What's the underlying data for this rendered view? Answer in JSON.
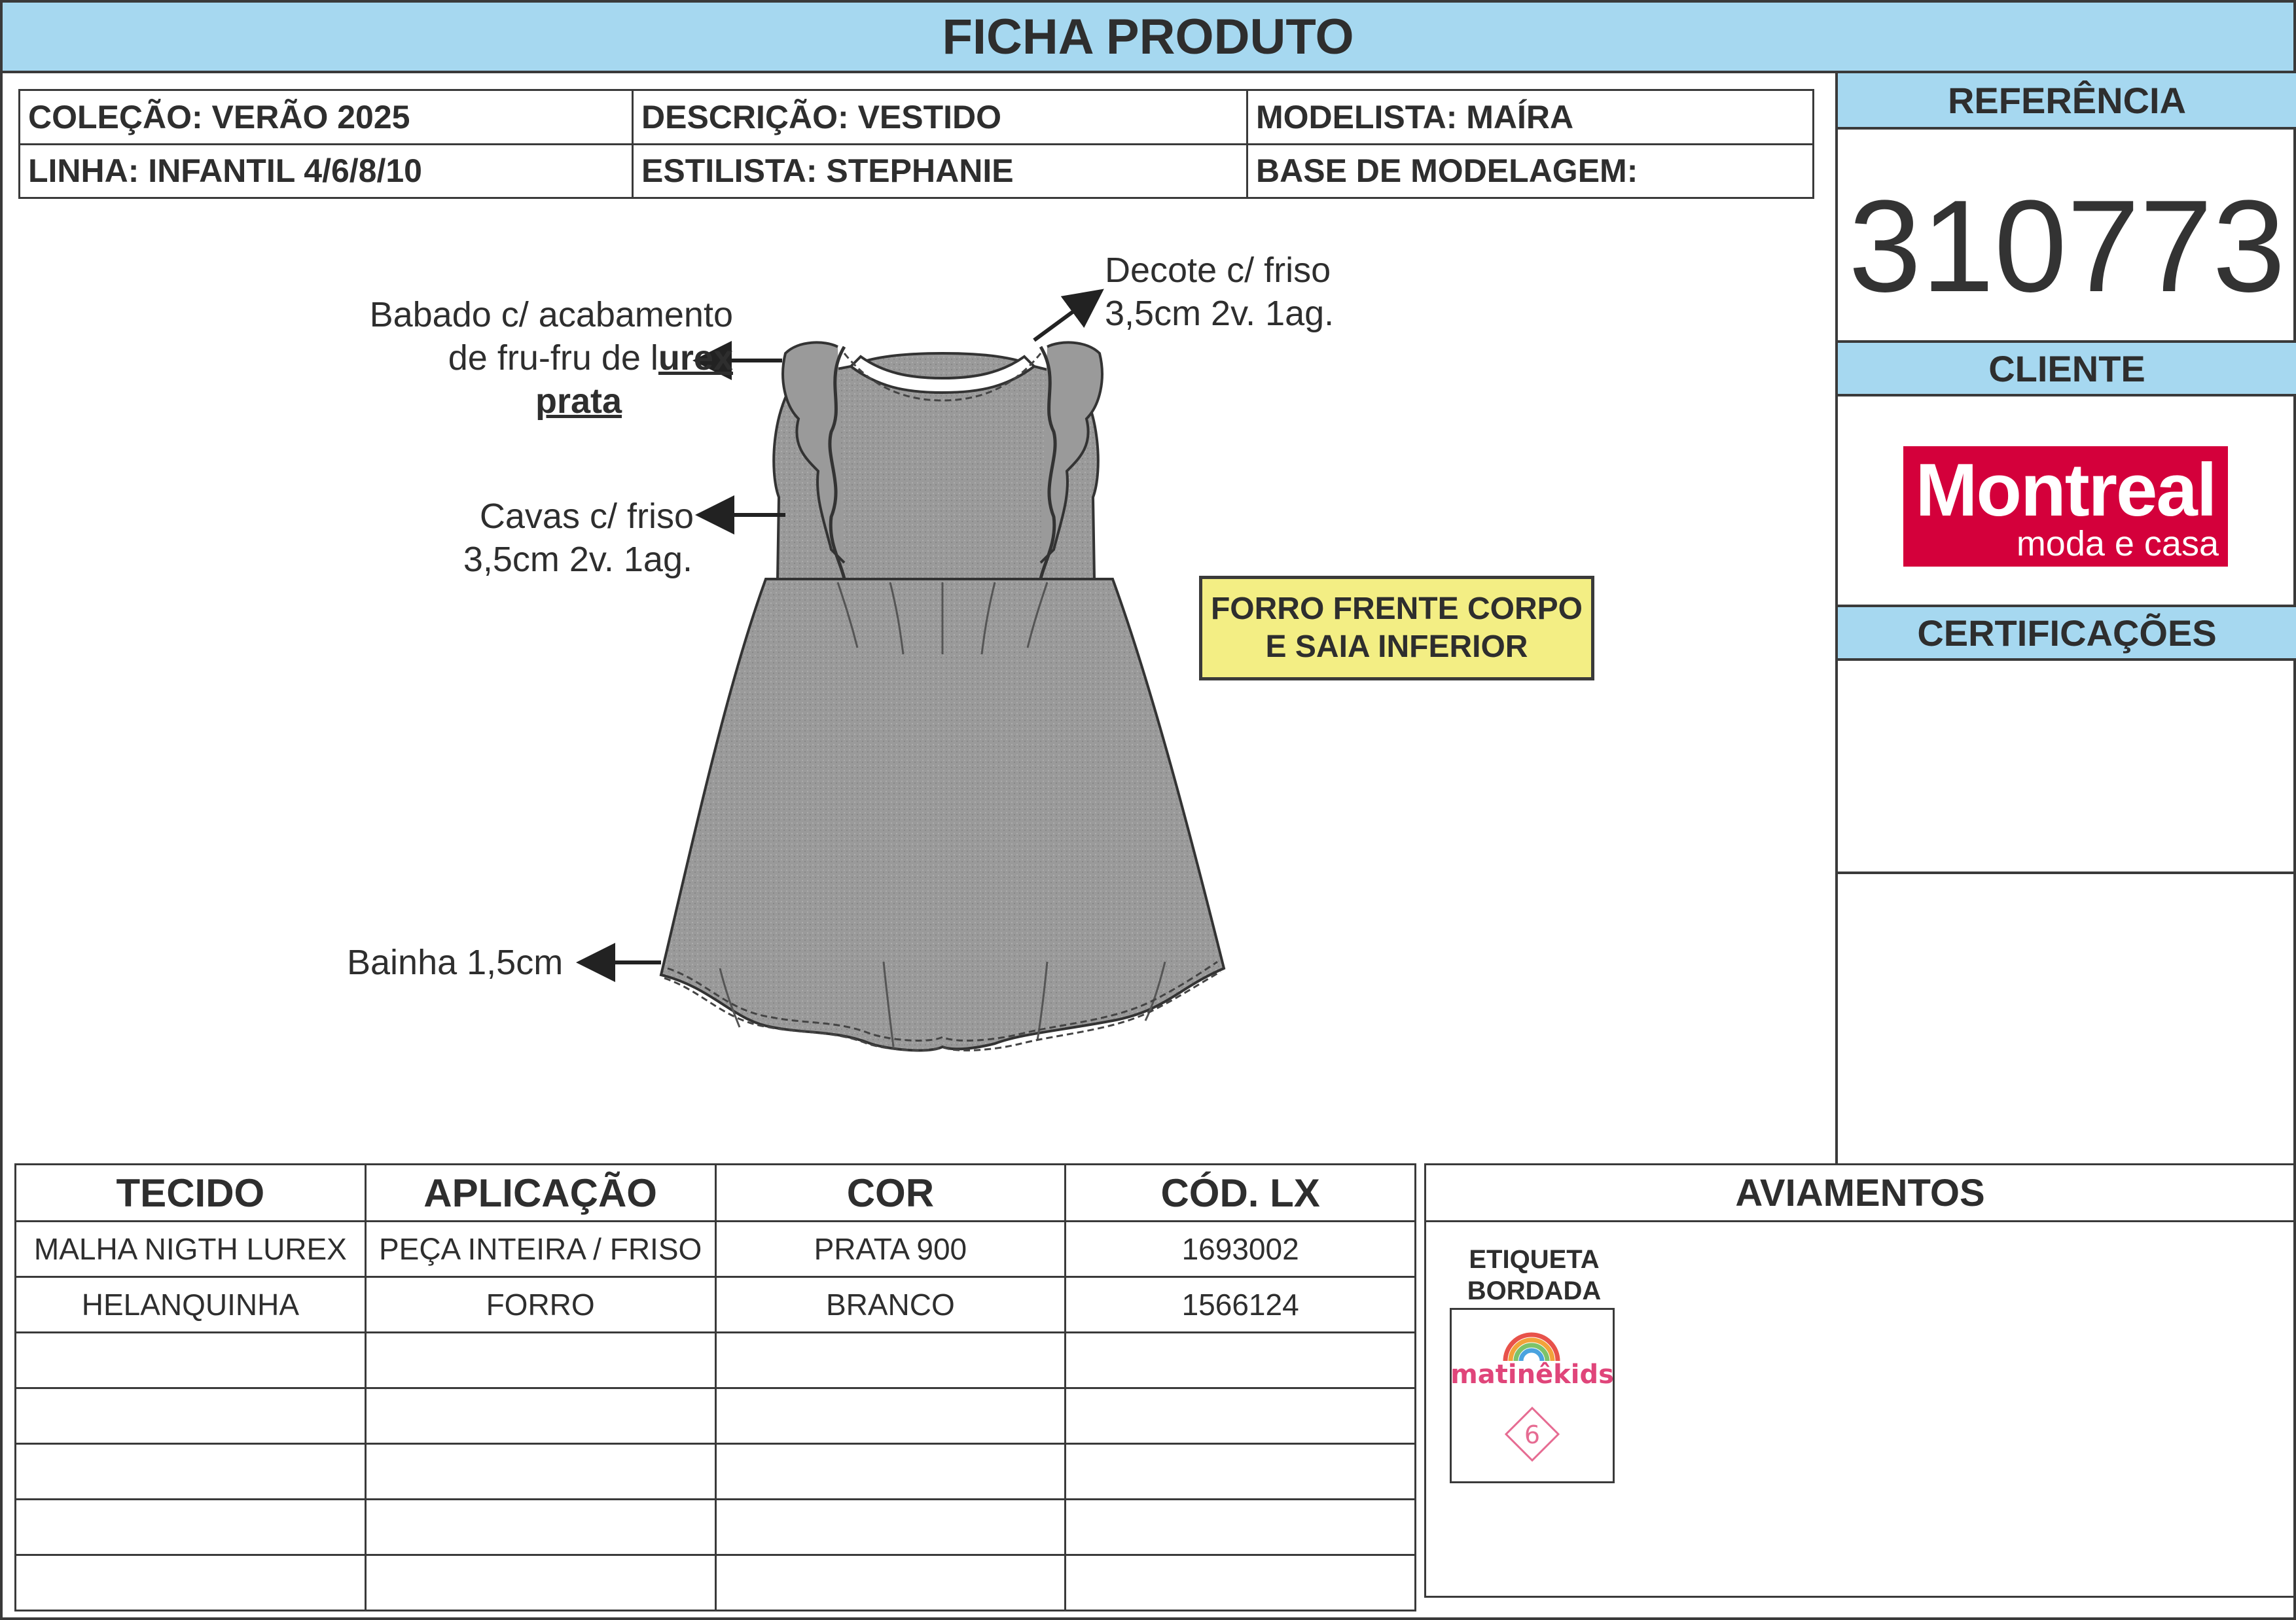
{
  "header": {
    "title": "FICHA PRODUTO"
  },
  "info": {
    "colecao": "COLEÇÃO: VERÃO 2025",
    "descricao": "DESCRIÇÃO: VESTIDO",
    "modelista": "MODELISTA: MAÍRA",
    "linha": "LINHA: INFANTIL 4/6/8/10",
    "estilista": "ESTILISTA: STEPHANIE",
    "base": "BASE DE MODELAGEM:"
  },
  "side": {
    "referencia_label": "REFERÊNCIA",
    "referencia_value": "310773",
    "cliente_label": "CLIENTE",
    "cliente_logo_main": "Montreal",
    "cliente_logo_sub": "moda e casa",
    "certificacoes_label": "CERTIFICAÇÕES"
  },
  "annotations": {
    "decote_1": "Decote c/ friso",
    "decote_2": "3,5cm 2v. 1ag.",
    "babado_1": "Babado c/ acabamento",
    "babado_2a": "de fru-fru de l",
    "babado_2b": "urex",
    "babado_3": "prata",
    "cavas_1": "Cavas c/ friso",
    "cavas_2": "3,5cm 2v. 1ag.",
    "bainha": "Bainha 1,5cm",
    "forro_1": "FORRO FRENTE CORPO",
    "forro_2": "E SAIA INFERIOR"
  },
  "fabric_table": {
    "headers": [
      "TECIDO",
      "APLICAÇÃO",
      "COR",
      "CÓD. LX"
    ],
    "rows": [
      [
        "MALHA NIGTH LUREX",
        "PEÇA INTEIRA / FRISO",
        "PRATA 900",
        "1693002"
      ],
      [
        "HELANQUINHA",
        "FORRO",
        "BRANCO",
        "1566124"
      ],
      [
        "",
        "",
        "",
        ""
      ],
      [
        "",
        "",
        "",
        ""
      ],
      [
        "",
        "",
        "",
        ""
      ],
      [
        "",
        "",
        "",
        ""
      ],
      [
        "",
        "",
        "",
        ""
      ]
    ]
  },
  "aviamentos": {
    "title": "AVIAMENTOS",
    "item_label_1": "ETIQUETA",
    "item_label_2": "BORDADA",
    "label_brand": "matinêkids",
    "label_size": "6"
  },
  "colors": {
    "header_blue": "#a6d8f0",
    "note_yellow": "#f3ee84",
    "brand_red": "#d4003b",
    "fabric_gray": "#9a9a9a"
  }
}
